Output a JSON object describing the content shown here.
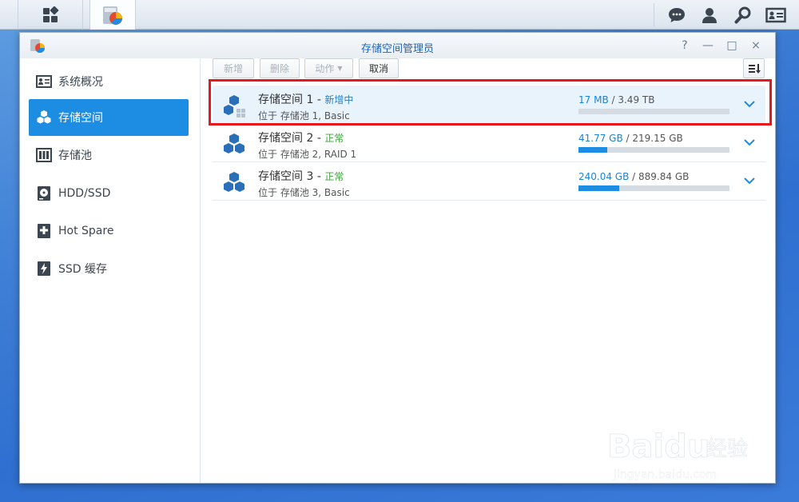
{
  "window": {
    "title": "存储空间管理员",
    "controls": [
      "?",
      "—",
      "□",
      "×"
    ]
  },
  "sidebar": {
    "items": [
      {
        "label": "系统概况",
        "icon": "overview-icon",
        "active": false
      },
      {
        "label": "存储空间",
        "icon": "volume-cubes-icon",
        "active": true
      },
      {
        "label": "存储池",
        "icon": "storage-pool-icon",
        "active": false
      },
      {
        "label": "HDD/SSD",
        "icon": "hdd-icon",
        "active": false
      },
      {
        "label": "Hot Spare",
        "icon": "hot-spare-icon",
        "active": false
      },
      {
        "label": "SSD 缓存",
        "icon": "ssd-cache-icon",
        "active": false
      }
    ]
  },
  "toolbar": {
    "create_label": "新增",
    "remove_label": "删除",
    "action_label": "动作",
    "cancel_label": "取消"
  },
  "volumes": [
    {
      "name": "存储空间 1",
      "status": "新增中",
      "status_color": "#1a84d6",
      "location": "位于 存储池 1, Basic",
      "used": "17 MB",
      "total": "3.49 TB",
      "usage_fraction": 0.0,
      "selected": true
    },
    {
      "name": "存储空间 2",
      "status": "正常",
      "status_color": "#3ba33b",
      "location": "位于 存储池 2, RAID 1",
      "used": "41.77 GB",
      "total": "219.15 GB",
      "usage_fraction": 0.19,
      "selected": false
    },
    {
      "name": "存储空间 3",
      "status": "正常",
      "status_color": "#3ba33b",
      "location": "位于 存储池 3, Basic",
      "used": "240.04 GB",
      "total": "889.84 GB",
      "usage_fraction": 0.27,
      "selected": false
    }
  ],
  "watermark": {
    "brand": "Baidu",
    "sub_cn": "经验",
    "url": "jingyan.baidu.com"
  },
  "colors": {
    "accent": "#1d8ce3",
    "highlight_border": "#e8171c"
  }
}
